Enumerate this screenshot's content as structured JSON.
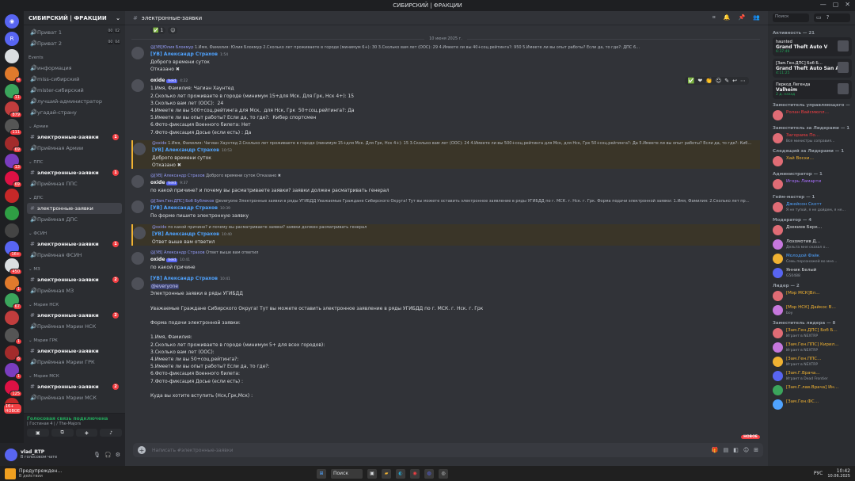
{
  "titlebar": {
    "title": "СИБИРСКИЙ | ФРАКЦИИ"
  },
  "servers": [
    {
      "label": "R",
      "badge": ""
    },
    {
      "label": "",
      "badge": ""
    },
    {
      "label": "",
      "badge": "4"
    },
    {
      "label": "",
      "badge": "11"
    },
    {
      "label": "",
      "badge": "879"
    },
    {
      "label": "",
      "badge": "111"
    },
    {
      "label": "",
      "badge": "69"
    },
    {
      "label": "",
      "badge": "13"
    },
    {
      "label": "",
      "badge": "69"
    },
    {
      "label": "",
      "badge": ""
    },
    {
      "label": "",
      "badge": ""
    },
    {
      "label": "",
      "badge": ""
    },
    {
      "label": "",
      "badge": "16+"
    },
    {
      "label": "",
      "badge": "450"
    },
    {
      "label": "",
      "badge": "1"
    },
    {
      "label": "",
      "badge": "67"
    },
    {
      "label": "",
      "badge": ""
    },
    {
      "label": "",
      "badge": "1"
    },
    {
      "label": "",
      "badge": "6"
    },
    {
      "label": "",
      "badge": "1"
    },
    {
      "label": "",
      "badge": "125"
    },
    {
      "label": "",
      "badge": "16+ НОВОЕ"
    }
  ],
  "server": {
    "name": "СИБИРСКИЙ | ФРАКЦИИ"
  },
  "channels": {
    "top": [
      {
        "name": "Приват 1",
        "counts": [
          "00",
          "02"
        ]
      },
      {
        "name": "Приват 2",
        "counts": [
          "00",
          "04"
        ]
      }
    ],
    "events_label": "Events",
    "events": [
      "информация",
      "miss-сибирский",
      "mister-сибирский",
      "лучший-администратор",
      "угадай-страну"
    ],
    "groups": [
      {
        "cat": "Армия",
        "ch": "электронные-заявки",
        "cnt": "1",
        "sub": "Приёмная Армии"
      },
      {
        "cat": "ППС",
        "ch": "электронные-заявки",
        "cnt": "1",
        "sub": "Приёмная ППС"
      },
      {
        "cat": "ДПС",
        "ch": "электронные-заявки",
        "cnt": "",
        "sub": "Приёмная ДПС",
        "active": true
      },
      {
        "cat": "ФСИН",
        "ch": "электронные-заявки",
        "cnt": "1",
        "sub": "Приёмная ФСИН"
      },
      {
        "cat": "МЗ",
        "ch": "электронные-заявки",
        "cnt": "2",
        "sub": "Приёмная МЗ"
      },
      {
        "cat": "Мэрия НСК",
        "ch": "электронные-заявки",
        "cnt": "2",
        "sub": "Приёмная Мэрии НСК"
      },
      {
        "cat": "Мэрия ГРК",
        "ch": "электронные-заявки",
        "cnt": "",
        "sub": "Приёмная Мэрии ГРК"
      },
      {
        "cat": "Мэрия МСК",
        "ch": "электронные-заявки",
        "cnt": "2",
        "sub": "Приёмная Мэрии МСК"
      }
    ]
  },
  "voice": {
    "status": "Голосовая связь подключена",
    "sub": "| Гостиная 4 | / The-Majors"
  },
  "user": {
    "name": "vlad_RTP",
    "status": "В голосовом чате"
  },
  "header": {
    "channel": "электронные-заявки"
  },
  "date_divider": "10 июня 2025 г.",
  "messages": [
    {
      "reply": "@[УВ]Юлия Блокмур",
      "reply_rest": " 1.Имя, Фамилия: Юлия Блокмур 2.Сколько лет проживаете в городе (минимум 6+): 30 3.Сколько вам лет (ООС): 29 4.Имеете ли вы 40+соц.рейтинга?: 950 5.Имеете ли вы опыт работы? Если да, то где?: ДПС 6…",
      "name": "[УВ] Александр Страхов",
      "blue": true,
      "time": "1:54",
      "text": "Доброго времени суток\nОтказано ✖",
      "hl": false
    },
    {
      "reply": "",
      "reply_rest": "",
      "name": "oxide",
      "tag": "held",
      "blue": false,
      "time": "4:22",
      "text": "1.Имя, Фамилия: Чагиан Хаунтед\n2.Сколько лет проживаете в городе (минимум 15+для Мск. Для Грк, Нск 4+): 15\n3.Сколько вам лет (ООС):  24\n4.Имеете ли вы 500+соц.рейтинга для Мск,  для Нск, Грк  50+соц.рейтинга?: Да\n5.Имеете ли вы опыт работы? Если да, то где?:  Кибер спортсмен\n6.Фото-фиксация Военного билета: Нет\n7.Фото-фиксация Досье (если есть) : Да",
      "hl": false
    },
    {
      "reply": "@oxide",
      "reply_rest": " 1.Имя, Фамилия: Чагиан Хаунтед 2.Сколько лет проживаете в городе (минимум 15+для Мск. Для Грк, Нск 4+): 15 3.Сколько вам лет (ООС): 24 4.Имеете ли вы 500+соц.рейтинга для Мск, для Нск, Грк 50+соц.рейтинга?: Да 5.Имеете ли вы опыт работы? Если да, то где?: Киб…",
      "name": "[УВ] Александр Страхов",
      "blue": true,
      "time": "10:53",
      "text": "Доброго времени суток\nОтказано ✖",
      "hl": true
    },
    {
      "reply": "@[УВ] Александр Страхов",
      "reply_rest": " Доброго времени суток Отказано ✖",
      "name": "oxide",
      "tag": "held",
      "blue": false,
      "time": "9:37",
      "text": "по какой причине? и почему вы расматриваете заявки? заявки должен расматривать генерал",
      "hl": false
    },
    {
      "reply": "@[Зам.Ген.ДПС] Боб Бублеков",
      "reply_rest": " @everyone Электронные заявки в ряды УГИБДД Уважаемые Граждане Сибирского Округа! Тут вы можете оставить электронное заявление в ряды УГИБДД по г. МСК. г. Нск. г. Грк. Форма подачи электронной заявки: 1.Имя, Фамилия: 2.Сколько лет пр…",
      "name": "[УВ] Александр Страхов",
      "blue": true,
      "time": "10:39",
      "text": "По форме пишите электронную заявку",
      "hl": false
    },
    {
      "reply": "@oxide",
      "reply_rest": " по какой причине? и почему вы расматриваете заявки? заявки должен расматривать генерал",
      "name": "[УВ] Александр Страхов",
      "blue": true,
      "time": "10:40",
      "text": "Ответ выше вам ответил",
      "hl": true
    },
    {
      "reply": "@[УВ] Александр Страхов",
      "reply_rest": " Ответ выше вам ответил",
      "name": "oxide",
      "tag": "held",
      "blue": false,
      "time": "10:41",
      "text": "по какой причине",
      "hl": false
    },
    {
      "reply": "",
      "reply_rest": "",
      "name": "[УВ] Александр Страхов",
      "blue": true,
      "time": "10:41",
      "mention": "@everyone",
      "text": "Электронные заявки в ряды УГИБДД\n\nУважаемые Граждане Сибирского Округа! Тут вы можете оставить электронное заявление в ряды УГИБДД по г. МСК. г. Нск. г. Грк\n\nФорма подачи электронной заявки:\n\n1.Имя, Фамилия:\n2.Сколько лет проживаете в городе (минимум 5+ для всех городов):\n3.Сколько вам лет (ООС):\n4.Имеете ли вы 50+соц.рейтинга?:\n5.Имеете ли вы опыт работы? Если да, то где?:\n6.Фото-фиксация Военного билета:\n7.Фото-фиксация Досье (если есть) :\n\nКуда вы хотите вступить (Нск,Грк,Мск) :",
      "hl": false
    }
  ],
  "new_pill": "НОВОЕ",
  "composer": {
    "placeholder": "Написать #электронные-заявки"
  },
  "search": {
    "placeholder": "Поиск"
  },
  "members": {
    "activity_label": "Активность — 21",
    "activities": [
      {
        "name": "haunted",
        "game": "Grand Theft Auto V",
        "time": "6:37:49"
      },
      {
        "name": "[Зам.Ген.ДПС] Боб Б…",
        "game": "Grand Theft Auto San Andr…",
        "time": "4:11:25"
      },
      {
        "name": "Перкод Легенда",
        "game": "Valheim",
        "time": "2 д. назад"
      }
    ],
    "groups": [
      {
        "cat": "Заместитель управляющего — 1",
        "items": [
          {
            "n": "Ролан Вайсмюлл…",
            "s": "",
            "c": "#f23f43"
          }
        ]
      },
      {
        "cat": "Заместитель за Лидерами — 1",
        "items": [
          {
            "n": "Загорама По…",
            "s": "Все министры соправия…",
            "c": "#f23f43"
          }
        ]
      },
      {
        "cat": "Следящий за Лидерами — 1",
        "items": [
          {
            "n": "Хай Восхи…",
            "s": "",
            "c": "#f0b232"
          }
        ]
      },
      {
        "cat": "Администратор — 1",
        "items": [
          {
            "n": "Игорь Ламарти",
            "s": "",
            "c": "#a970ff"
          }
        ]
      },
      {
        "cat": "Гейм-мастер — 1",
        "items": [
          {
            "n": "Джейсон Скотт",
            "s": "Я не тупой, я не дойдем, я не…",
            "c": "#4fa3ff"
          }
        ]
      },
      {
        "cat": "Модератор — 4",
        "items": [
          {
            "n": "Дзекиев Берк…",
            "s": "",
            "c": "#dbdee1"
          },
          {
            "n": "Лохомотив Д…",
            "s": "Дельта мне сказал о…",
            "c": "#dbdee1"
          },
          {
            "n": "Молодой Фэйк",
            "s": "Семь персонажей во мне…",
            "c": "#4fa3ff"
          },
          {
            "n": "Янник Белый",
            "s": "G50488",
            "c": "#dbdee1"
          }
        ]
      },
      {
        "cat": "Лидер — 2",
        "items": [
          {
            "n": "[Мэр МСК]Вл…",
            "s": "",
            "c": "#f0b232"
          },
          {
            "n": "[Мэр НСК] Дайкос В…",
            "s": "boy",
            "c": "#f0b232"
          }
        ]
      },
      {
        "cat": "Заместитель лидера — 8",
        "items": [
          {
            "n": "[Зам.Ген.ДПС] Боб Б…",
            "s": "Играет в NEXTRP",
            "c": "#f0b232"
          },
          {
            "n": "[Зам.Ген.ППС] Кирил…",
            "s": "Играет в NEXTRP",
            "c": "#f0b232"
          },
          {
            "n": "[Зам.Ген.ППС…",
            "s": "Играет в NEXTRP",
            "c": "#f0b232"
          },
          {
            "n": "[Зам.Г.Врача…",
            "s": "Играет в Dead Frontier",
            "c": "#f0b232"
          },
          {
            "n": "[Зам.Г.лав.Врача] Ин…",
            "s": "",
            "c": "#f0b232"
          },
          {
            "n": "[Зам.Ген.ФС…",
            "s": "",
            "c": "#f0b232"
          }
        ]
      }
    ]
  },
  "taskbar": {
    "weather": "Предупрежден…",
    "weather_sub": "В действии",
    "search": "Поиск",
    "lang": "РУС",
    "time": "10:42",
    "date": "10.06.2025"
  }
}
